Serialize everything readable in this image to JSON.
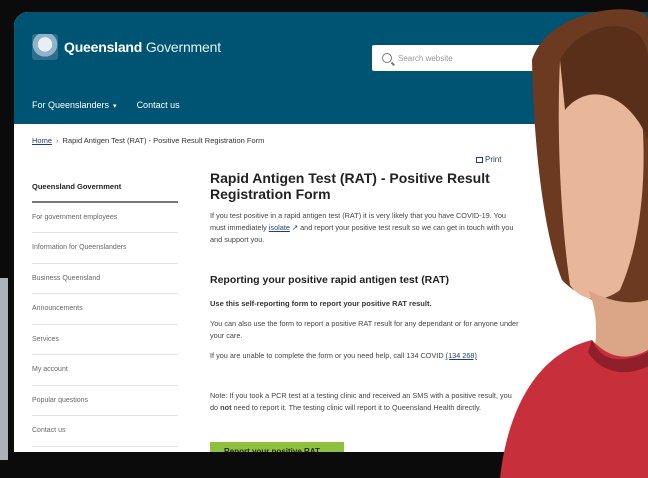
{
  "header": {
    "logo_bold": "Queensland",
    "logo_light": "Government",
    "search_placeholder": "Search website"
  },
  "nav": {
    "items": [
      {
        "label": "For Queenslanders"
      },
      {
        "label": "Contact us"
      }
    ]
  },
  "breadcrumb": {
    "home": "Home",
    "current": "Rapid Antigen Test (RAT) - Positive Result Registration Form"
  },
  "sidebar": {
    "items": [
      "Queensland Government",
      "For government employees",
      "Information for Queenslanders",
      "Business Queensland",
      "Announcements",
      "Services",
      "My account",
      "Popular questions",
      "Contact us"
    ]
  },
  "main": {
    "print_label": "Print",
    "title": "Rapid Antigen Test (RAT) - Positive Result Registration Form",
    "intro_part1": "If you test positive in a rapid antigen test (RAT) it is very likely that you have COVID-19. You must immediately",
    "intro_link": "isolate",
    "intro_part2": "and report your positive test result so we can get in touch with you and support you.",
    "subheading": "Reporting your positive rapid antigen test (RAT)",
    "bold_line": "Use this self-reporting form to report your positive RAT result.",
    "para_also": "You can also use the form to report a positive RAT result for any dependant or for anyone under your care.",
    "para_help_part1": "If you are unable to complete the form or you need help, call 134 COVID",
    "para_help_phone": "(134 268)",
    "para_note_part1": "Note: If you took a PCR test at a testing clinic and received an SMS with a positive result, you do",
    "para_note_not": "not",
    "para_note_part2": "need to report it. The testing clinic will report it to Queensland Health directly.",
    "report_button": "Report your positive RAT"
  },
  "colors": {
    "header_bg": "#005473",
    "button_bg": "#8fbf3f",
    "link": "#1e3f7a"
  }
}
